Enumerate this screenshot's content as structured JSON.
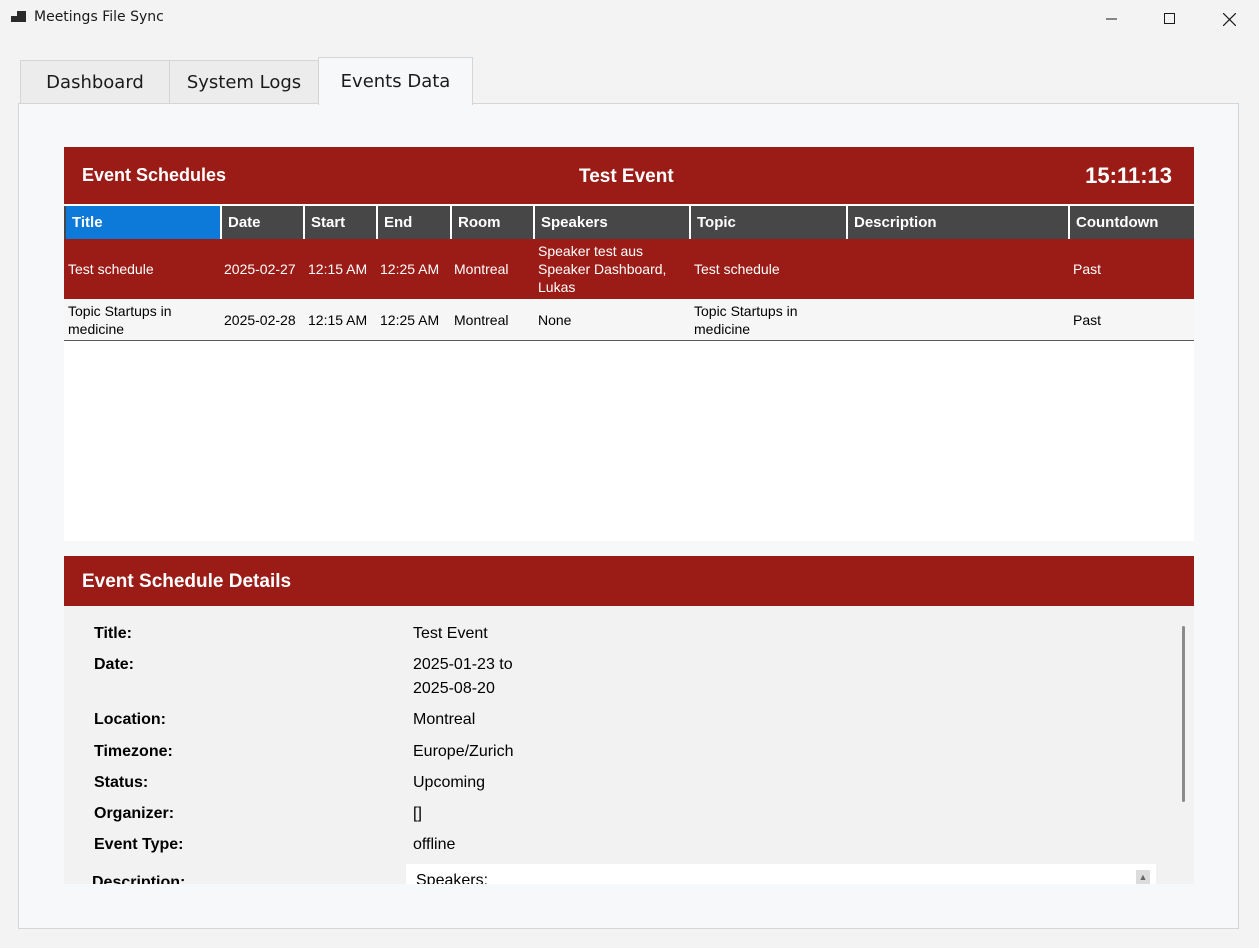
{
  "window": {
    "title": "Meetings File Sync"
  },
  "tabs": [
    {
      "label": "Dashboard"
    },
    {
      "label": "System Logs"
    },
    {
      "label": "Events Data"
    }
  ],
  "schedules": {
    "panel_title": "Event Schedules",
    "event_name": "Test Event",
    "clock": "15:11:13",
    "columns": [
      "Title",
      "Date",
      "Start",
      "End",
      "Room",
      "Speakers",
      "Topic",
      "Description",
      "Countdown"
    ],
    "rows": [
      {
        "title": "Test schedule",
        "date": "2025-02-27",
        "start": "12:15 AM",
        "end": "12:25 AM",
        "room": "Montreal",
        "speakers": "Speaker test aus Speaker Dashboard, Lukas",
        "topic": "Test schedule",
        "description": "",
        "countdown": "Past"
      },
      {
        "title": "Topic Startups in medicine",
        "date": "2025-02-28",
        "start": "12:15 AM",
        "end": "12:25 AM",
        "room": "Montreal",
        "speakers": "None",
        "topic": "Topic Startups in medicine",
        "description": "",
        "countdown": "Past"
      }
    ]
  },
  "details": {
    "panel_title": "Event Schedule Details",
    "fields": {
      "title_label": "Title:",
      "title_value": "Test Event",
      "date_label": "Date:",
      "date_value_line1": "2025-01-23 to",
      "date_value_line2": "2025-08-20",
      "location_label": "Location:",
      "location_value": "Montreal",
      "timezone_label": "Timezone:",
      "timezone_value": "Europe/Zurich",
      "status_label": "Status:",
      "status_value": "Upcoming",
      "organizer_label": "Organizer:",
      "organizer_value": "[]",
      "event_type_label": "Event Type:",
      "event_type_value": "offline",
      "description_label": "Description:",
      "description_value": "Speakers:"
    }
  },
  "colors": {
    "header_red": "#9b1b16",
    "grid_header": "#474747",
    "selected_header": "#0d7ad9"
  }
}
